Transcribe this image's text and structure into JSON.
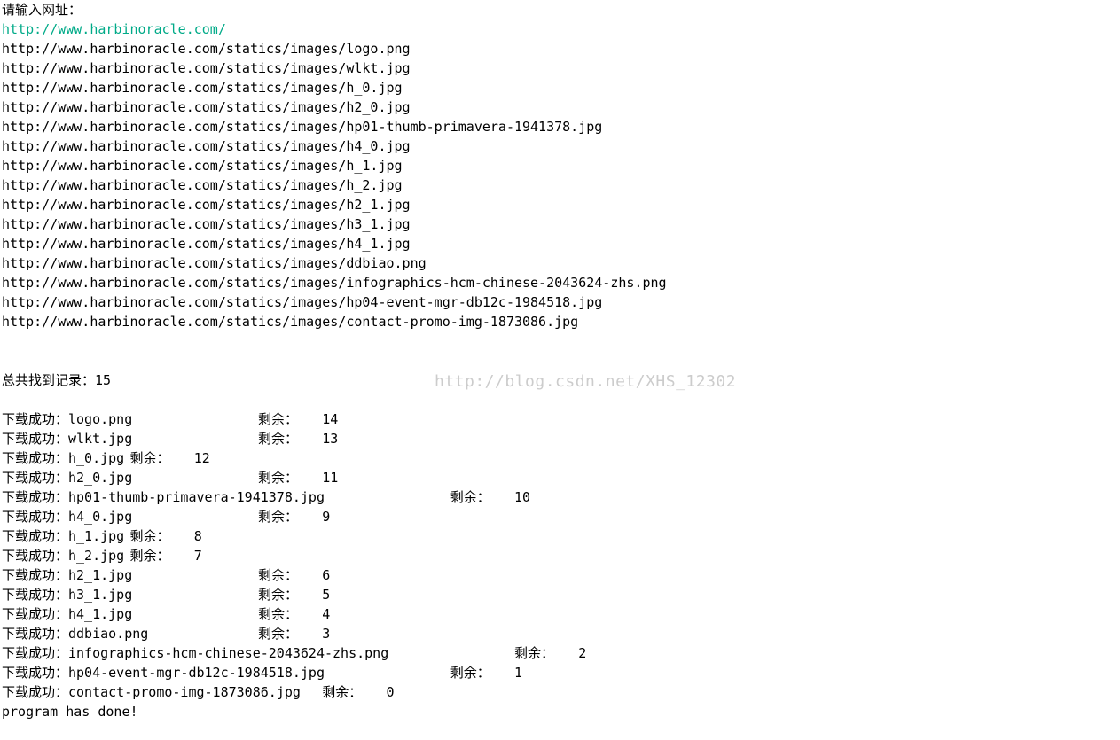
{
  "prompt_label": "请输入网址：",
  "input_url": "http://www.harbinoracle.com/",
  "urls": [
    "http://www.harbinoracle.com/statics/images/logo.png",
    "http://www.harbinoracle.com/statics/images/wlkt.jpg",
    "http://www.harbinoracle.com/statics/images/h_0.jpg",
    "http://www.harbinoracle.com/statics/images/h2_0.jpg",
    "http://www.harbinoracle.com/statics/images/hp01-thumb-primavera-1941378.jpg",
    "http://www.harbinoracle.com/statics/images/h4_0.jpg",
    "http://www.harbinoracle.com/statics/images/h_1.jpg",
    "http://www.harbinoracle.com/statics/images/h_2.jpg",
    "http://www.harbinoracle.com/statics/images/h2_1.jpg",
    "http://www.harbinoracle.com/statics/images/h3_1.jpg",
    "http://www.harbinoracle.com/statics/images/h4_1.jpg",
    "http://www.harbinoracle.com/statics/images/ddbiao.png",
    "http://www.harbinoracle.com/statics/images/infographics-hcm-chinese-2043624-zhs.png",
    "http://www.harbinoracle.com/statics/images/hp04-event-mgr-db12c-1984518.jpg",
    "http://www.harbinoracle.com/statics/images/contact-promo-img-1873086.jpg"
  ],
  "summary_line": "总共找到记录：15",
  "downloads": [
    "下载成功：logo.png\t\t剩余：\t14",
    "下载成功：wlkt.jpg\t\t剩余：\t13",
    "下载成功：h_0.jpg\t剩余：\t12",
    "下载成功：h2_0.jpg\t\t剩余：\t11",
    "下载成功：hp01-thumb-primavera-1941378.jpg\t\t剩余：\t10",
    "下载成功：h4_0.jpg\t\t剩余：\t9",
    "下载成功：h_1.jpg\t剩余：\t8",
    "下载成功：h_2.jpg\t剩余：\t7",
    "下载成功：h2_1.jpg\t\t剩余：\t6",
    "下载成功：h3_1.jpg\t\t剩余：\t5",
    "下载成功：h4_1.jpg\t\t剩余：\t4",
    "下载成功：ddbiao.png\t\t剩余：\t3",
    "下载成功：infographics-hcm-chinese-2043624-zhs.png\t\t剩余：\t2",
    "下载成功：hp04-event-mgr-db12c-1984518.jpg\t\t剩余：\t1",
    "下载成功：contact-promo-img-1873086.jpg\t剩余：\t0"
  ],
  "done_line": "program has done!",
  "watermark_text": "http://blog.csdn.net/XHS_12302"
}
